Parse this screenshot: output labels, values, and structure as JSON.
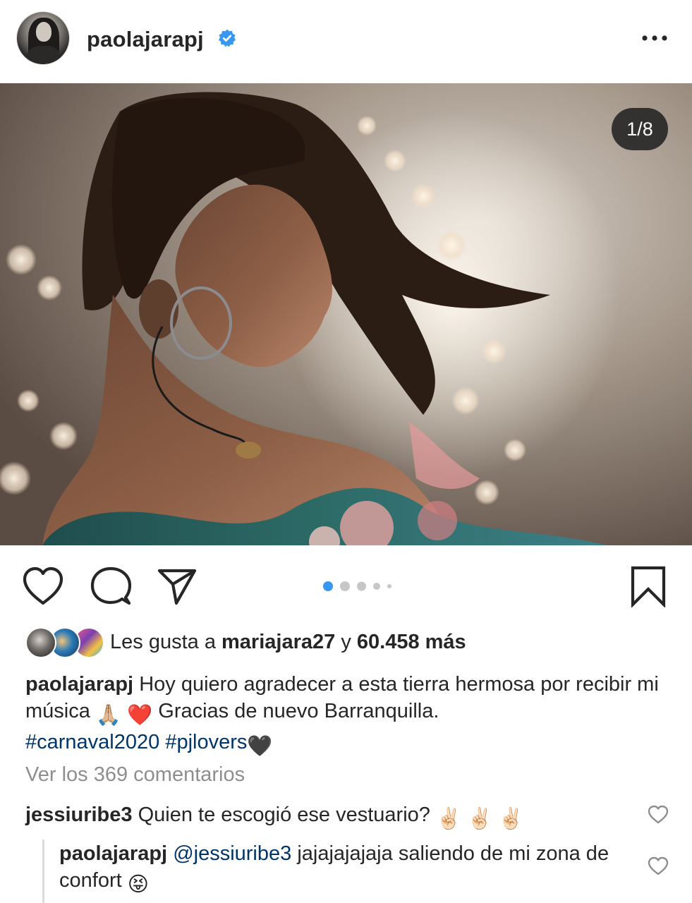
{
  "post": {
    "username": "paolajarapj",
    "verified": true,
    "carousel_counter": "1/8",
    "carousel": {
      "total_dots": 5,
      "active_index": 0
    }
  },
  "likes": {
    "prefix": "Les gusta a",
    "user": "mariajara27",
    "connector": "y",
    "count_text": "60.458 más"
  },
  "caption": {
    "username": "paolajarapj",
    "text_1": "Hoy quiero agradecer a esta tierra hermosa por recibir mi música",
    "emoji_1": "🙏🏼",
    "emoji_2": "❤️",
    "text_2": "Gracias de nuevo Barranquilla.",
    "hashtag_1": "#carnaval2020",
    "hashtag_2": "#pjlovers",
    "emoji_3": "🖤"
  },
  "view_comments": "Ver los 369 comentarios",
  "comments": [
    {
      "username": "jessiuribe3",
      "text": "Quien te escogió ese vestuario?",
      "emoji": "✌🏻 ✌🏻 ✌🏻"
    }
  ],
  "reply": {
    "username": "paolajarapj",
    "mention": "@jessiuribe3",
    "text": "jajajajajaja saliendo de mi zona de confort",
    "emoji": "😝"
  },
  "colors": {
    "text": "#262626",
    "secondary": "#8e8e8e",
    "link": "#003569",
    "accent": "#3897f0",
    "verified": "#3897f0"
  },
  "icons": [
    "verified-badge-icon",
    "more-options-icon",
    "heart-icon",
    "comment-icon",
    "share-icon",
    "bookmark-icon"
  ]
}
